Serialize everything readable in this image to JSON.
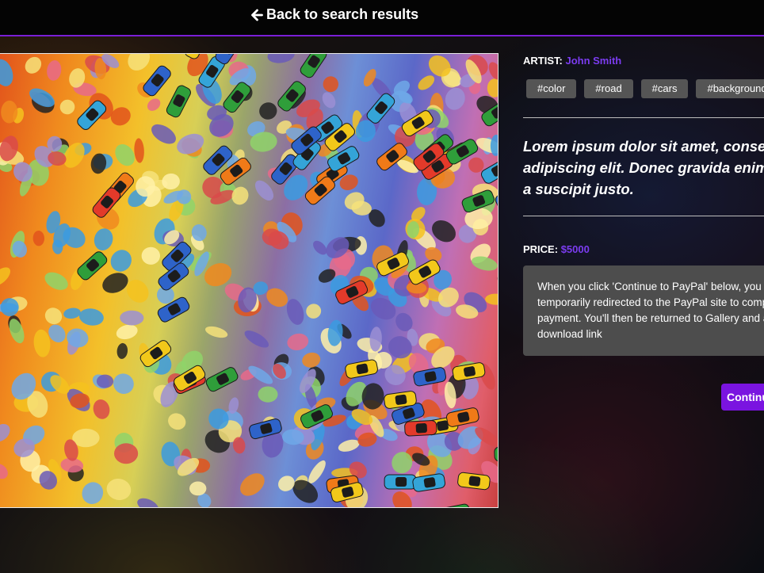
{
  "header": {
    "back_label": "Back to search results"
  },
  "artwork": {
    "alt": "Colorful painted road with toy cars"
  },
  "details": {
    "artist_label": "ARTIST:",
    "artist_name": "John Smith",
    "tags": [
      "#color",
      "#road",
      "#cars",
      "#background"
    ],
    "description_lines": [
      "Lorem ipsum dolor sit amet, consectetur",
      "adipiscing elit. Donec gravida enim",
      "a suscipit justo."
    ],
    "price_label": "PRICE:",
    "price_value": "$5000",
    "notice_lines": [
      "When you click 'Continue to PayPal' below, you will be",
      "temporarily redirected to the PayPal site to complete",
      "payment. You'll then be returned to Gallery and a",
      "download link"
    ],
    "continue_label": "Continue to PayPal"
  },
  "colors": {
    "accent": "#7a14e0",
    "link": "#7b3cf0",
    "tag_bg": "#555555",
    "notice_bg": "#4d4d4d",
    "header_bg": "#040404"
  }
}
